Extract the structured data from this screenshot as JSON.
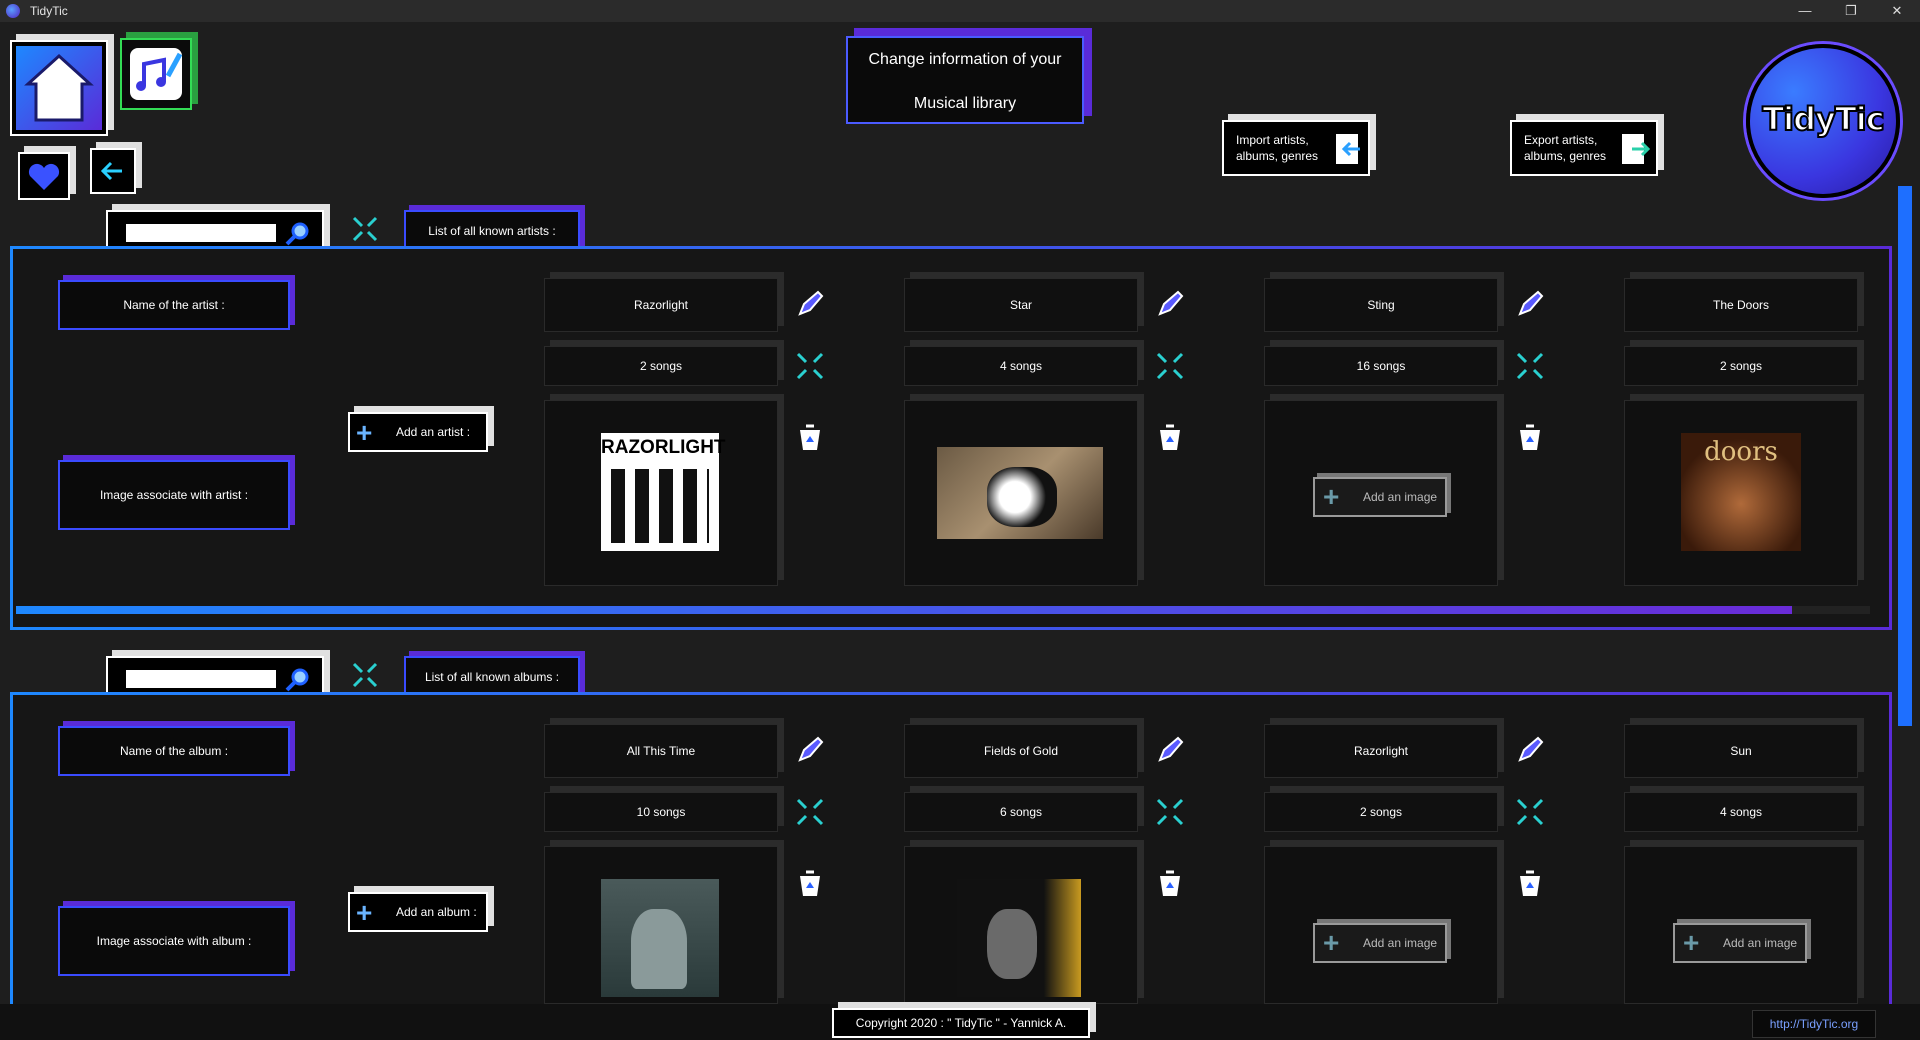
{
  "window": {
    "title": "TidyTic",
    "controls": [
      "—",
      "❐",
      "✕"
    ]
  },
  "header": {
    "title_line1": "Change information of your",
    "title_line2": "Musical library",
    "import_line1": "Import artists,",
    "import_line2": "albums, genres",
    "export_line1": "Export artists,",
    "export_line2": "albums, genres",
    "logo_text": "TidyTic"
  },
  "artists": {
    "tab_label": "List of all known artists :",
    "name_label": "Name of the artist :",
    "image_label": "Image associate with artist :",
    "add_label": "Add an artist :",
    "items": [
      {
        "name": "Razorlight",
        "count": "2 songs",
        "image": "razorlight"
      },
      {
        "name": "Star",
        "count": "4 songs",
        "image": "dog"
      },
      {
        "name": "Sting",
        "count": "16 songs",
        "image": ""
      },
      {
        "name": "The Doors",
        "count": "2 songs",
        "image": "doors"
      }
    ]
  },
  "albums": {
    "tab_label": "List of all known albums :",
    "name_label": "Name of the album :",
    "image_label": "Image associate with album :",
    "add_label": "Add an album :",
    "items": [
      {
        "name": "All This Time",
        "count": "10 songs",
        "image": "sting1"
      },
      {
        "name": "Fields of Gold",
        "count": "6 songs",
        "image": "sting2"
      },
      {
        "name": "Razorlight",
        "count": "2 songs",
        "image": ""
      },
      {
        "name": "Sun",
        "count": "4 songs",
        "image": ""
      }
    ]
  },
  "add_image_label": "Add an image",
  "footer": {
    "copyright": "Copyright 2020 : \" TidyTic \" - Yannick A.",
    "link": "http://TidyTic.org"
  },
  "colors": {
    "accent_blue": "#1e88ff",
    "accent_purple": "#5a2bd8",
    "background": "#1e1e1e"
  },
  "icons": [
    "home-icon",
    "music-edit-icon",
    "heart-icon",
    "back-arrow-icon",
    "search-icon",
    "expand-icon",
    "pencil-icon",
    "trash-icon",
    "plus-icon",
    "import-icon",
    "export-icon"
  ]
}
